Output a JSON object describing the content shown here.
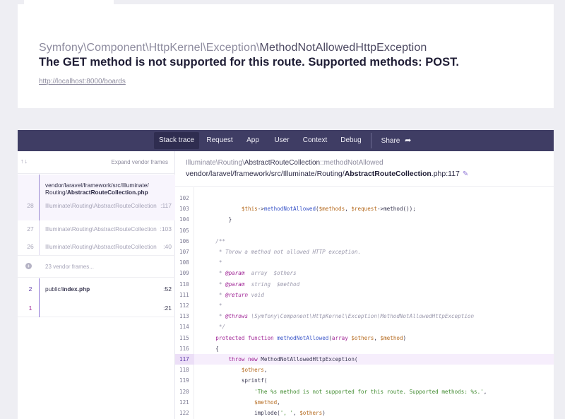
{
  "exception": {
    "namespace": "Symfony\\Component\\HttpKernel\\Exception\\",
    "class": "MethodNotAllowedHttpException",
    "message": "The GET method is not supported for this route. Supported methods: POST.",
    "url": "http://localhost:8000/boards"
  },
  "nav": {
    "items": [
      {
        "label": "Stack trace"
      },
      {
        "label": "Request"
      },
      {
        "label": "App"
      },
      {
        "label": "User"
      },
      {
        "label": "Context"
      },
      {
        "label": "Debug"
      }
    ],
    "share_label": "Share",
    "share_icon": "share-arrow-icon"
  },
  "frames": {
    "sort_icon": "↑↓",
    "expand_label": "Expand vendor frames",
    "active": {
      "path_prefix": "vendor/laravel/framework/src/Illuminate/",
      "path_dir": "Routing/",
      "path_file": "AbstractRouteCollection.php"
    },
    "items": [
      {
        "num": "28",
        "path": "Illuminate\\Routing\\AbstractRouteCollection",
        "line": ":117"
      },
      {
        "num": "27",
        "path": "Illuminate\\Routing\\AbstractRouteCollection",
        "line": ":103"
      },
      {
        "num": "26",
        "path": "Illuminate\\Routing\\AbstractRouteCollection",
        "line": ":40"
      }
    ],
    "vendor_collapsed": "23 vendor frames...",
    "app_frames": [
      {
        "num": "2",
        "path_prefix": "public/",
        "path_file": "index.php",
        "line": ":52"
      },
      {
        "num": "1",
        "path_prefix": "",
        "path_file": "",
        "line": ":21"
      }
    ]
  },
  "code_header": {
    "method_ns": "Illuminate\\Routing\\",
    "method_cls": "AbstractRouteCollection",
    "method_name": "::methodNotAllowed",
    "file_prefix": "vendor/laravel/framework/src/Illuminate/Routing/",
    "file_name": "AbstractRouteCollection",
    "file_ext": ".php:117",
    "edit_icon": "pencil-icon"
  },
  "code": {
    "highlight_line": "117",
    "lines": [
      {
        "n": "102",
        "t": ""
      },
      {
        "n": "103",
        "t": "            $this->methodNotAllowed($methods, $request->method());"
      },
      {
        "n": "104",
        "t": "        }"
      },
      {
        "n": "105",
        "t": ""
      },
      {
        "n": "106",
        "t": "    /**"
      },
      {
        "n": "107",
        "t": "     * Throw a method not allowed HTTP exception."
      },
      {
        "n": "108",
        "t": "     *"
      },
      {
        "n": "109",
        "t": "     * @param  array  $others"
      },
      {
        "n": "110",
        "t": "     * @param  string  $method"
      },
      {
        "n": "111",
        "t": "     * @return void"
      },
      {
        "n": "112",
        "t": "     *"
      },
      {
        "n": "113",
        "t": "     * @throws \\Symfony\\Component\\HttpKernel\\Exception\\MethodNotAllowedHttpException"
      },
      {
        "n": "114",
        "t": "     */"
      },
      {
        "n": "115",
        "t": "    protected function methodNotAllowed(array $others, $method)"
      },
      {
        "n": "116",
        "t": "    {"
      },
      {
        "n": "117",
        "t": "        throw new MethodNotAllowedHttpException("
      },
      {
        "n": "118",
        "t": "            $others,"
      },
      {
        "n": "119",
        "t": "            sprintf("
      },
      {
        "n": "120",
        "t": "                'The %s method is not supported for this route. Supported methods: %s.',"
      },
      {
        "n": "121",
        "t": "                $method,"
      },
      {
        "n": "122",
        "t": "                implode(', ', $others)"
      }
    ]
  }
}
